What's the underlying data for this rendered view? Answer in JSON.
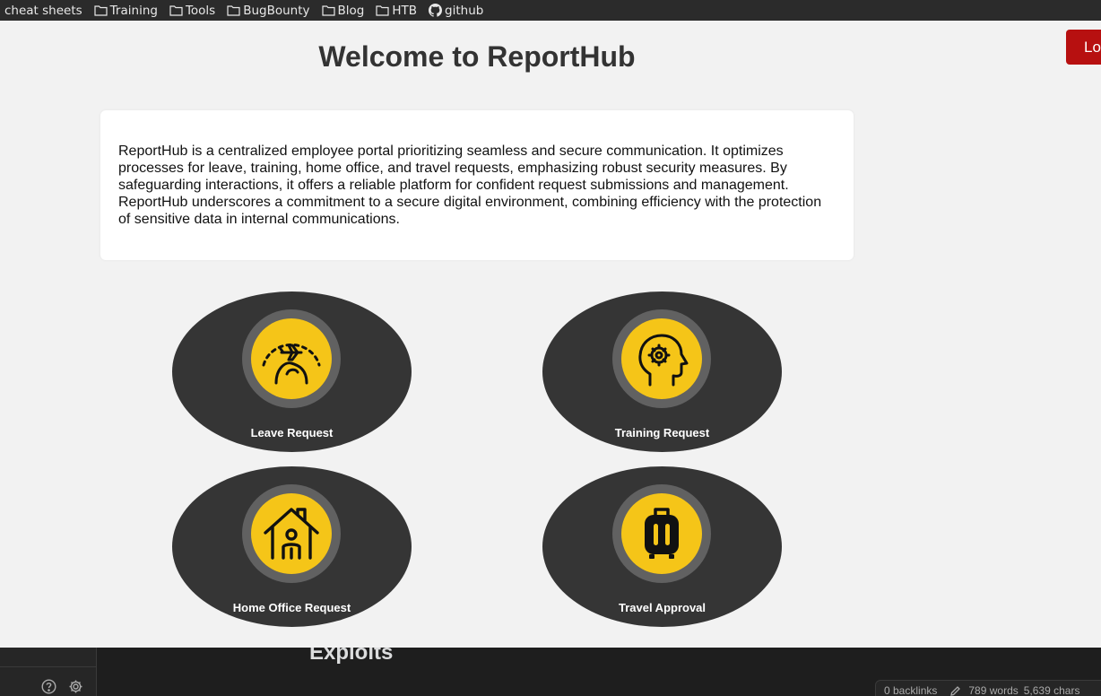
{
  "bookmarks": [
    {
      "label": "cheat sheets",
      "icon": "none"
    },
    {
      "label": "Training",
      "icon": "folder-icon"
    },
    {
      "label": "Tools",
      "icon": "folder-icon"
    },
    {
      "label": "BugBounty",
      "icon": "folder-icon"
    },
    {
      "label": "Blog",
      "icon": "folder-icon"
    },
    {
      "label": "HTB",
      "icon": "folder-icon"
    },
    {
      "label": "github",
      "icon": "github-icon"
    }
  ],
  "page": {
    "title": "Welcome to ReportHub",
    "logout_label": "Lo",
    "intro": "ReportHub is a centralized employee portal prioritizing seamless and secure communication. It optimizes processes for leave, training, home office, and travel requests, emphasizing robust security measures. By safeguarding interactions, it offers a reliable platform for confident request submissions and management. ReportHub underscores a commitment to a secure digital environment, combining efficiency with the protection of sensitive data in internal communications.",
    "cards": [
      {
        "label": "Leave Request",
        "icon": "plane-globe-icon"
      },
      {
        "label": "Training Request",
        "icon": "head-gear-icon"
      },
      {
        "label": "Home Office Request",
        "icon": "house-person-icon"
      },
      {
        "label": "Travel Approval",
        "icon": "luggage-icon"
      }
    ]
  },
  "app": {
    "heading": "Exploits",
    "status": {
      "backlinks": "0 backlinks",
      "words": "789 words",
      "chars": "5,639 chars"
    }
  },
  "colors": {
    "accent_yellow": "#f5c518",
    "card_bg": "#353535",
    "logout_red": "#b71010"
  }
}
